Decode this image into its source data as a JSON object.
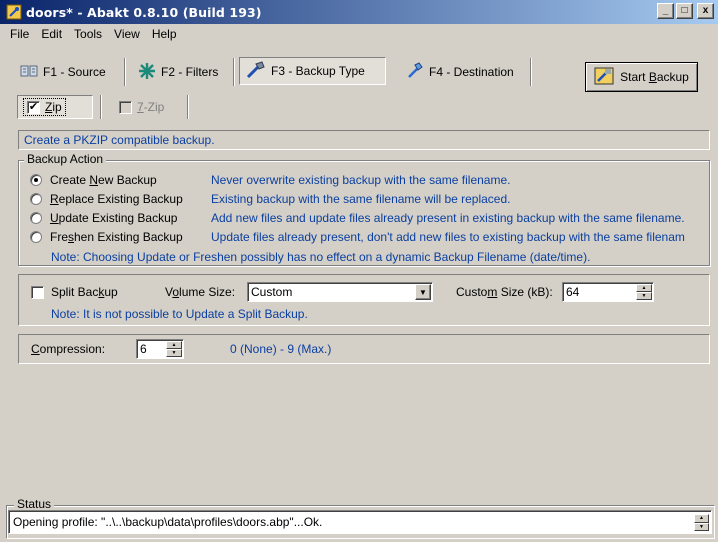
{
  "window": {
    "title": "doors* - Abakt 0.8.10 (Build 193)",
    "minimize": "_",
    "maximize": "□",
    "close": "x"
  },
  "menu": [
    "File",
    "Edit",
    "Tools",
    "View",
    "Help"
  ],
  "toolbar": {
    "tabs": [
      {
        "label": "F1 - Source",
        "icon": "source-icon",
        "pressed": false
      },
      {
        "label": "F2 - Filters",
        "icon": "filters-icon",
        "pressed": false
      },
      {
        "label": "F3 - Backup Type",
        "icon": "backup-type-icon",
        "pressed": true
      },
      {
        "label": "F4 - Destination",
        "icon": "destination-icon",
        "pressed": false
      }
    ],
    "start_backup_prefix": "Start ",
    "start_backup_access": "B",
    "start_backup_rest": "ackup"
  },
  "format": {
    "zip": {
      "access": "Z",
      "rest": "ip",
      "checked": true
    },
    "sevenzip": {
      "access": "7",
      "rest": "-Zip",
      "checked": false,
      "enabled": false
    }
  },
  "description": "Create a PKZIP compatible backup.",
  "backup_action": {
    "legend": "Backup Action",
    "options": [
      {
        "pre": "Create ",
        "key": "N",
        "post": "ew Backup",
        "desc": "Never overwrite existing backup with the same filename.",
        "selected": true
      },
      {
        "pre": "",
        "key": "R",
        "post": "eplace Existing Backup",
        "desc": "Existing backup with the same filename will be replaced.",
        "selected": false
      },
      {
        "pre": "",
        "key": "U",
        "post": "pdate Existing Backup",
        "desc": "Add new files and update files already present in existing backup with the same filename.",
        "selected": false
      },
      {
        "pre": "Fre",
        "key": "s",
        "post": "hen Existing Backup",
        "desc": "Update files already present, don't add new files to existing backup with the same filenam",
        "selected": false
      }
    ],
    "note": "Note: Choosing Update or Freshen possibly has no effect on a dynamic Backup Filename (date/time)."
  },
  "split": {
    "checkbox_pre": "Split Bac",
    "checkbox_key": "k",
    "checkbox_post": "up",
    "checked": false,
    "volume_label_pre": "V",
    "volume_label_key": "o",
    "volume_label_post": "lume Size:",
    "volume_value": "Custom",
    "custom_label_pre": "Custo",
    "custom_label_key": "m",
    "custom_label_post": " Size (kB):",
    "custom_value": "64",
    "note": "Note: It is not possible to Update a Split Backup."
  },
  "compression": {
    "label_key": "C",
    "label_rest": "ompression:",
    "value": "6",
    "range": "0 (None) - 9 (Max.)"
  },
  "status": {
    "legend": "Status",
    "text": "Opening profile: \"..\\..\\backup\\data\\profiles\\doors.abp\"...Ok."
  }
}
